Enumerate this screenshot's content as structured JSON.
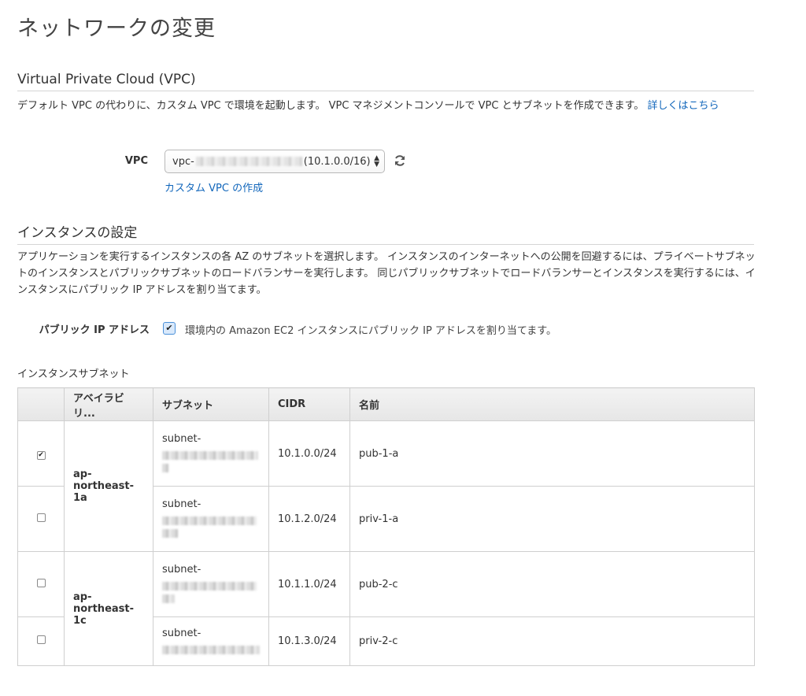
{
  "page": {
    "title": "ネットワークの変更"
  },
  "vpc_section": {
    "title": "Virtual Private Cloud (VPC)",
    "description": "デフォルト VPC の代わりに、カスタム VPC で環境を起動します。 VPC マネジメントコンソールで VPC とサブネットを作成できます。 ",
    "learn_more_link": "詳しくはこちら",
    "vpc_label": "VPC",
    "vpc_select_prefix": "vpc-",
    "vpc_select_suffix": "(10.1.0.0/16)",
    "refresh_icon": "refresh-icon",
    "create_vpc_link": "カスタム VPC の作成"
  },
  "instance_section": {
    "title": "インスタンスの設定",
    "description": "アプリケーションを実行するインスタンスの各 AZ のサブネットを選択します。 インスタンスのインターネットへの公開を回避するには、プライベートサブネットのインスタンスとパブリックサブネットのロードバランサーを実行します。 同じパブリックサブネットでロードバランサーとインスタンスを実行するには、インスタンスにパブリック IP アドレスを割り当てます。",
    "public_ip_label": "パブリック IP アドレス",
    "public_ip_checked": true,
    "public_ip_text": "環境内の Amazon EC2 インスタンスにパブリック IP アドレスを割り当てます。",
    "subnets_label": "インスタンスサブネット"
  },
  "subnet_table": {
    "headers": {
      "az": "アベイラビリ...",
      "subnet": "サブネット",
      "cidr": "CIDR",
      "name": "名前"
    },
    "az_groups": [
      "ap-northeast-1a",
      "ap-northeast-1c"
    ],
    "rows": [
      {
        "checked": true,
        "subnet": "subnet-",
        "cidr": "10.1.0.0/24",
        "name": "pub-1-a"
      },
      {
        "checked": false,
        "subnet": "subnet-",
        "cidr": "10.1.2.0/24",
        "name": "priv-1-a"
      },
      {
        "checked": false,
        "subnet": "subnet-",
        "cidr": "10.1.1.0/24",
        "name": "pub-2-c"
      },
      {
        "checked": false,
        "subnet": "subnet-",
        "cidr": "10.1.3.0/24",
        "name": "priv-2-c"
      }
    ]
  },
  "colors": {
    "link": "#1166bb",
    "header_bg": "#e9e9e9",
    "border": "#cfcfcf"
  }
}
